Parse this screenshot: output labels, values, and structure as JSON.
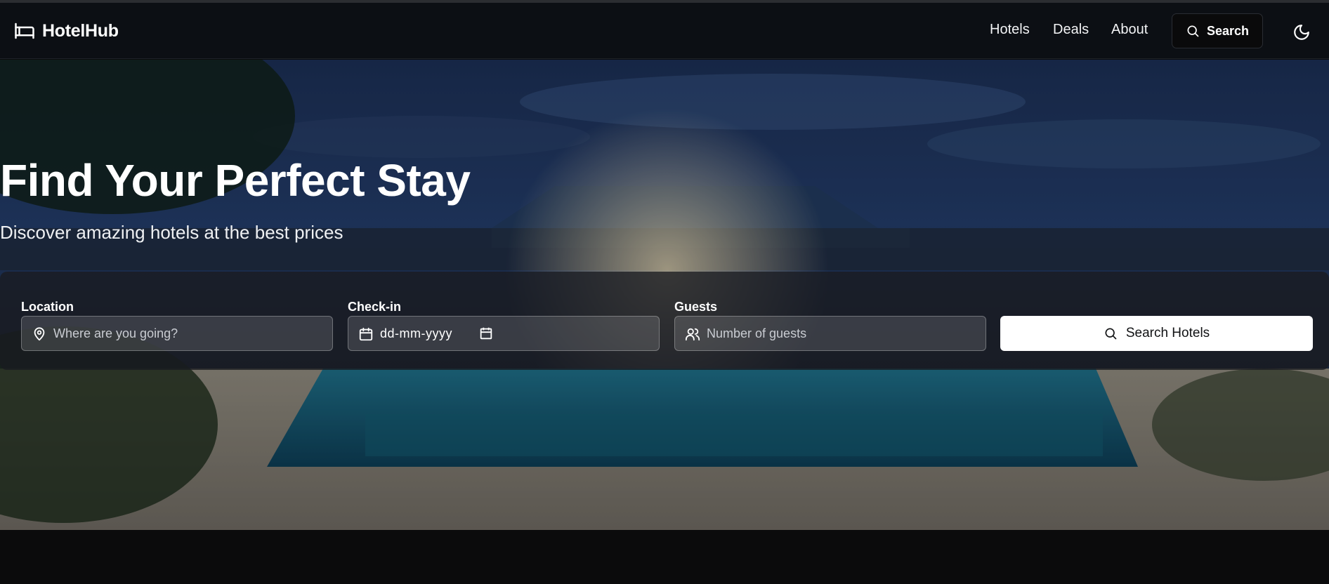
{
  "brand": {
    "name": "HotelHub",
    "icon": "bed-icon"
  },
  "nav": {
    "links": [
      "Hotels",
      "Deals",
      "About"
    ],
    "search_label": "Search",
    "search_icon": "search-icon",
    "theme_icon": "moon-icon"
  },
  "hero": {
    "title": "Find Your Perfect Stay",
    "subtitle": "Discover amazing hotels at the best prices"
  },
  "search": {
    "location": {
      "label": "Location",
      "placeholder": "Where are you going?",
      "icon": "map-pin-icon"
    },
    "checkin": {
      "label": "Check-in",
      "value": "dd-mm-yyyy",
      "icon": "calendar-icon"
    },
    "guests": {
      "label": "Guests",
      "placeholder": "Number of guests",
      "icon": "users-icon"
    },
    "submit_label": "Search Hotels"
  },
  "colors": {
    "page_bg": "#0b0b0c",
    "nav_bg": "#0c0f14",
    "button_bg": "#ffffff"
  }
}
